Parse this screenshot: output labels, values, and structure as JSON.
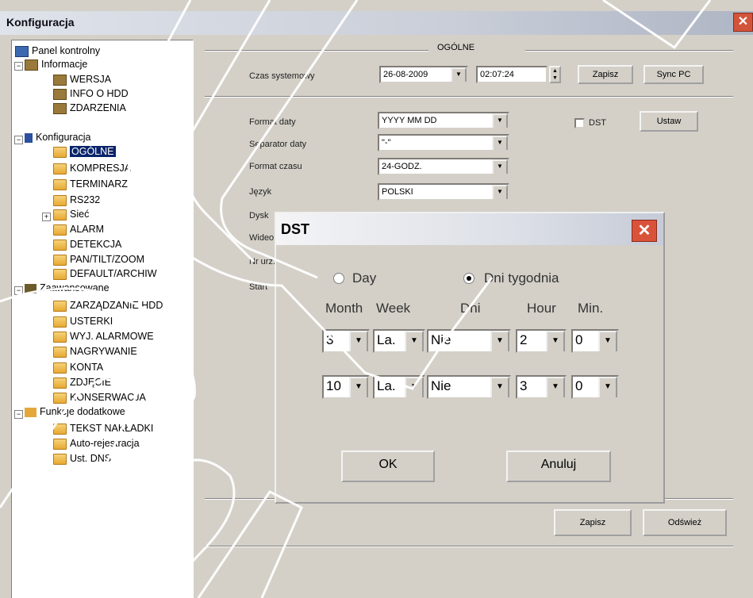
{
  "window": {
    "title": "Konfiguracja",
    "close_symbol": "✕"
  },
  "tree": {
    "panel_kontrolny": "Panel kontrolny",
    "informacje": "Informacje",
    "wersja": "WERSJA",
    "info_hdd": "INFO O HDD",
    "zdarzenia": "ZDARZENIA",
    "konfiguracja": "Konfiguracja",
    "ogolne": "OGÓLNE",
    "kompresja": "KOMPRESJA",
    "terminarz": "TERMINARZ",
    "rs232": "RS232",
    "siec": "Sieć",
    "alarm": "ALARM",
    "detekcja": "DETEKCJA",
    "pantilt": "PAN/TILT/ZOOM",
    "default": "DEFAULT/ARCHIW",
    "zaawansowane": "Zaawansowane",
    "zarzadzanie": "ZARZĄDZANIE HDD",
    "usterki": "USTERKI",
    "wyj_alarmowe": "WYJ. ALARMOWE",
    "nagrywanie": "NAGRYWANIE",
    "konta": "KONTA",
    "zdjecie": "ZDJĘCIE",
    "konserwacja": "KONSERWACJA",
    "funkcje": "Funkcje dodatkowe",
    "tekst": "TEKST NAKŁADKI",
    "autorej": "Auto-rejestracja",
    "dns": "Ust. DNS"
  },
  "general": {
    "group_title": "OGÓLNE",
    "czas_label": "Czas systemowy",
    "date_value": "26-08-2009",
    "time_value": "02:07:24",
    "zapisz_top": "Zapisz",
    "sync": "Sync PC",
    "format_daty_label": "Format daty",
    "format_daty_value": "YYYY MM DD",
    "dst_label": "DST",
    "ustaw": "Ustaw",
    "separator_label": "Separator daty",
    "separator_value": "\"-\"",
    "format_czasu_label": "Format czasu",
    "format_czasu_value": "24-GODZ.",
    "jezyk_label": "Język",
    "jezyk_value": "POLSKI",
    "dysk_label": "Dysk",
    "video_label": "Wideo",
    "nr_label": "Nr urz.",
    "start_label": "Start",
    "zapisz_bottom": "Zapisz",
    "odswiez": "Odśwież"
  },
  "dst": {
    "title": "DST",
    "close_symbol": "✕",
    "day_label": "Day",
    "dni_tygodnia_label": "Dni tygodnia",
    "selected_mode": "Dni tygodnia",
    "col_month": "Month",
    "col_week": "Week",
    "col_dni": "Dni",
    "col_hour": "Hour",
    "col_min": "Min.",
    "start": {
      "month": "3",
      "week": "La.",
      "day": "Nie",
      "hour": "2",
      "min": "0"
    },
    "end": {
      "month": "10",
      "week": "La.",
      "day": "Nie",
      "hour": "3",
      "min": "0"
    },
    "ok": "OK",
    "anuluj": "Anuluj"
  },
  "icons": {
    "dropdown": "▼",
    "expand_minus": "−",
    "expand_plus": "+"
  }
}
